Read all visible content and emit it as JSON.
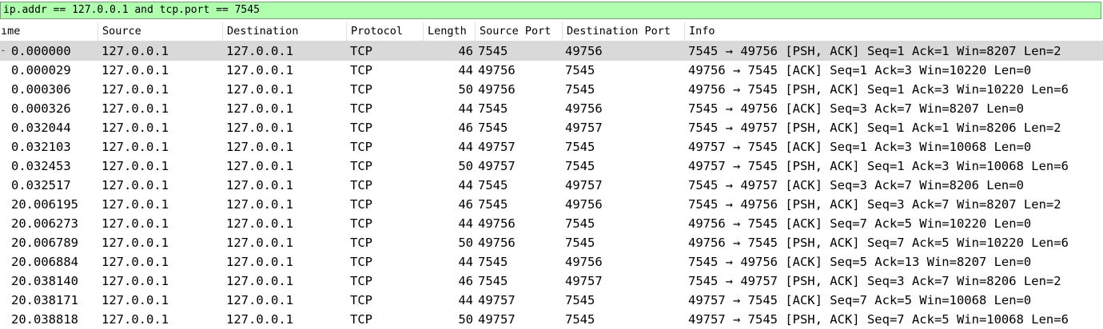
{
  "filter": {
    "value": "ip.addr == 127.0.0.1 and tcp.port == 7545 "
  },
  "columns": [
    {
      "key": "time",
      "label": "ıme"
    },
    {
      "key": "source",
      "label": "Source"
    },
    {
      "key": "destination",
      "label": "Destination"
    },
    {
      "key": "protocol",
      "label": "Protocol"
    },
    {
      "key": "length",
      "label": "Length"
    },
    {
      "key": "sport",
      "label": "Source Port"
    },
    {
      "key": "dport",
      "label": "Destination Port"
    },
    {
      "key": "info",
      "label": "Info"
    }
  ],
  "selected_row_index": 0,
  "rows": [
    {
      "time": "0.000000",
      "source": "127.0.0.1",
      "destination": "127.0.0.1",
      "protocol": "TCP",
      "length": "46",
      "sport": "7545",
      "dport": "49756",
      "info": "7545 → 49756 [PSH, ACK] Seq=1 Ack=1 Win=8207 Len=2"
    },
    {
      "time": "0.000029",
      "source": "127.0.0.1",
      "destination": "127.0.0.1",
      "protocol": "TCP",
      "length": "44",
      "sport": "49756",
      "dport": "7545",
      "info": "49756 → 7545 [ACK] Seq=1 Ack=3 Win=10220 Len=0"
    },
    {
      "time": "0.000306",
      "source": "127.0.0.1",
      "destination": "127.0.0.1",
      "protocol": "TCP",
      "length": "50",
      "sport": "49756",
      "dport": "7545",
      "info": "49756 → 7545 [PSH, ACK] Seq=1 Ack=3 Win=10220 Len=6"
    },
    {
      "time": "0.000326",
      "source": "127.0.0.1",
      "destination": "127.0.0.1",
      "protocol": "TCP",
      "length": "44",
      "sport": "7545",
      "dport": "49756",
      "info": "7545 → 49756 [ACK] Seq=3 Ack=7 Win=8207 Len=0"
    },
    {
      "time": "0.032044",
      "source": "127.0.0.1",
      "destination": "127.0.0.1",
      "protocol": "TCP",
      "length": "46",
      "sport": "7545",
      "dport": "49757",
      "info": "7545 → 49757 [PSH, ACK] Seq=1 Ack=1 Win=8206 Len=2"
    },
    {
      "time": "0.032103",
      "source": "127.0.0.1",
      "destination": "127.0.0.1",
      "protocol": "TCP",
      "length": "44",
      "sport": "49757",
      "dport": "7545",
      "info": "49757 → 7545 [ACK] Seq=1 Ack=3 Win=10068 Len=0"
    },
    {
      "time": "0.032453",
      "source": "127.0.0.1",
      "destination": "127.0.0.1",
      "protocol": "TCP",
      "length": "50",
      "sport": "49757",
      "dport": "7545",
      "info": "49757 → 7545 [PSH, ACK] Seq=1 Ack=3 Win=10068 Len=6"
    },
    {
      "time": "0.032517",
      "source": "127.0.0.1",
      "destination": "127.0.0.1",
      "protocol": "TCP",
      "length": "44",
      "sport": "7545",
      "dport": "49757",
      "info": "7545 → 49757 [ACK] Seq=3 Ack=7 Win=8206 Len=0"
    },
    {
      "time": "20.006195",
      "source": "127.0.0.1",
      "destination": "127.0.0.1",
      "protocol": "TCP",
      "length": "46",
      "sport": "7545",
      "dport": "49756",
      "info": "7545 → 49756 [PSH, ACK] Seq=3 Ack=7 Win=8207 Len=2"
    },
    {
      "time": "20.006273",
      "source": "127.0.0.1",
      "destination": "127.0.0.1",
      "protocol": "TCP",
      "length": "44",
      "sport": "49756",
      "dport": "7545",
      "info": "49756 → 7545 [ACK] Seq=7 Ack=5 Win=10220 Len=0"
    },
    {
      "time": "20.006789",
      "source": "127.0.0.1",
      "destination": "127.0.0.1",
      "protocol": "TCP",
      "length": "50",
      "sport": "49756",
      "dport": "7545",
      "info": "49756 → 7545 [PSH, ACK] Seq=7 Ack=5 Win=10220 Len=6"
    },
    {
      "time": "20.006884",
      "source": "127.0.0.1",
      "destination": "127.0.0.1",
      "protocol": "TCP",
      "length": "44",
      "sport": "7545",
      "dport": "49756",
      "info": "7545 → 49756 [ACK] Seq=5 Ack=13 Win=8207 Len=0"
    },
    {
      "time": "20.038140",
      "source": "127.0.0.1",
      "destination": "127.0.0.1",
      "protocol": "TCP",
      "length": "46",
      "sport": "7545",
      "dport": "49757",
      "info": "7545 → 49757 [PSH, ACK] Seq=3 Ack=7 Win=8206 Len=2"
    },
    {
      "time": "20.038171",
      "source": "127.0.0.1",
      "destination": "127.0.0.1",
      "protocol": "TCP",
      "length": "44",
      "sport": "49757",
      "dport": "7545",
      "info": "49757 → 7545 [ACK] Seq=7 Ack=5 Win=10068 Len=0"
    },
    {
      "time": "20.038818",
      "source": "127.0.0.1",
      "destination": "127.0.0.1",
      "protocol": "TCP",
      "length": "50",
      "sport": "49757",
      "dport": "7545",
      "info": "49757 → 7545 [PSH, ACK] Seq=7 Ack=5 Win=10068 Len=6"
    }
  ],
  "colors": {
    "filter_valid_bg": "#afffaf",
    "selected_row_bg": "#d9d9d9"
  }
}
